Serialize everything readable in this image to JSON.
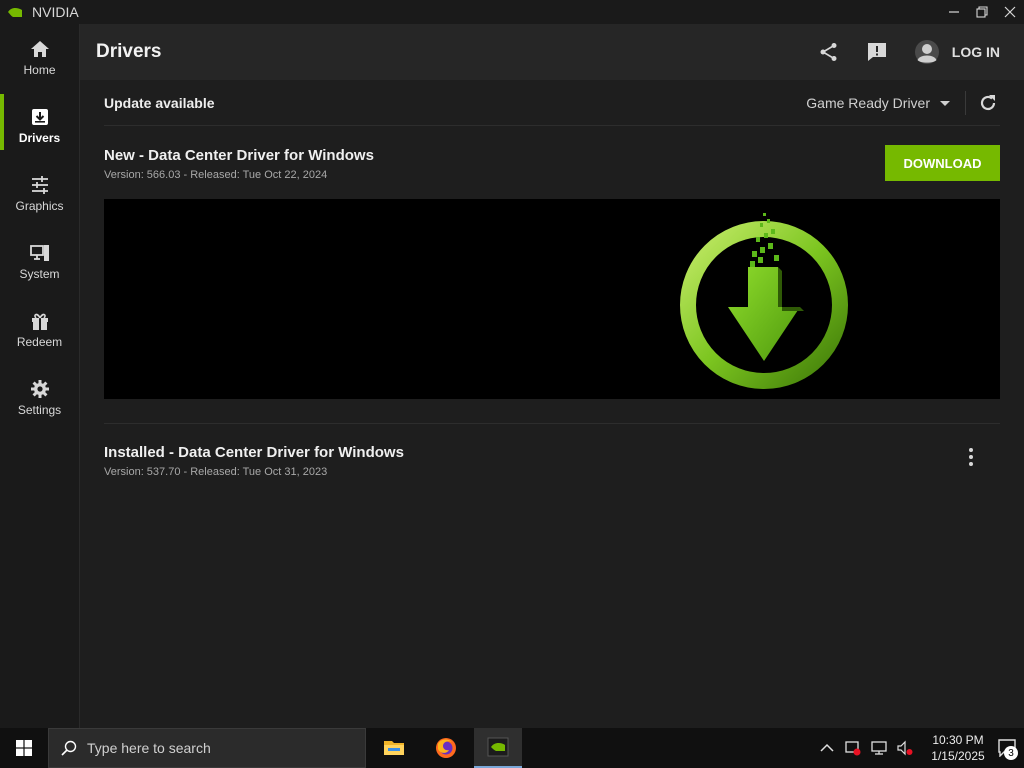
{
  "window": {
    "title": "NVIDIA",
    "minimize_icon": "minimize-icon",
    "restore_icon": "restore-icon",
    "close_icon": "close-icon"
  },
  "sidebar": {
    "items": [
      {
        "label": "Home",
        "icon": "home-icon",
        "active": false
      },
      {
        "label": "Drivers",
        "icon": "download-box-icon",
        "active": true
      },
      {
        "label": "Graphics",
        "icon": "sliders-icon",
        "active": false
      },
      {
        "label": "System",
        "icon": "monitor-tower-icon",
        "active": false
      },
      {
        "label": "Redeem",
        "icon": "gift-icon",
        "active": false
      },
      {
        "label": "Settings",
        "icon": "gear-icon",
        "active": false
      }
    ]
  },
  "header": {
    "title": "Drivers",
    "login_label": "LOG IN"
  },
  "drivers": {
    "update_label": "Update available",
    "driver_type": "Game Ready Driver",
    "new_driver": {
      "title": "New - Data Center Driver for Windows",
      "meta": "Version: 566.03 - Released: Tue Oct 22, 2024",
      "download_label": "DOWNLOAD"
    },
    "installed_driver": {
      "title": "Installed - Data Center Driver for Windows",
      "meta": "Version: 537.70 - Released: Tue Oct 31, 2023"
    }
  },
  "taskbar": {
    "search_placeholder": "Type here to search",
    "time": "10:30 PM",
    "date": "1/15/2025",
    "notification_count": "3"
  },
  "colors": {
    "accent": "#76b900",
    "background": "#1e1e1e",
    "header": "#262626"
  }
}
